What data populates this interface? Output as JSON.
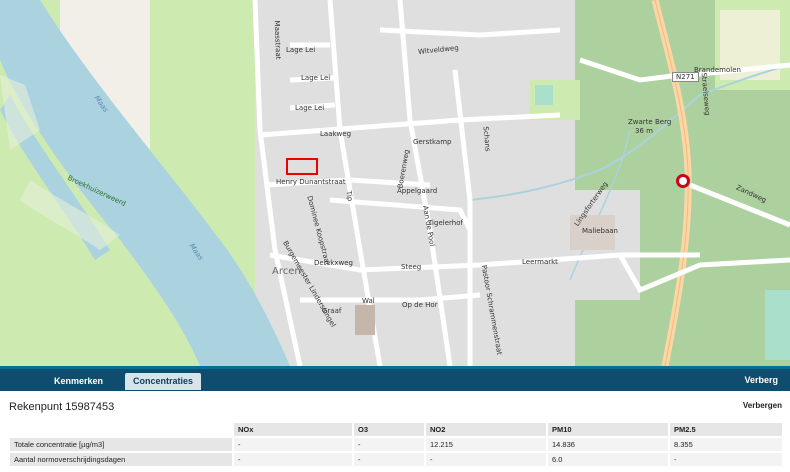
{
  "map": {
    "labels": {
      "lage_lei_1": "Lage Lei",
      "lage_lei_2": "Lage Lei",
      "lage_lei_3": "Lage Lei",
      "witveldweg": "Witveldweg",
      "laakweg": "Laakweg",
      "gerstkamp": "Gerstkamp",
      "henry_dunant": "Henry Dunantstraat",
      "dominee_koopstraat": "Dominee Koopstraat",
      "derckxweg": "Derckxweg",
      "arcen": "Arcen",
      "steeg": "Steeg",
      "leermarkt": "Leermarkt",
      "graaf": "Graaf",
      "op_de_hor": "Op de Hor",
      "wal": "Wal",
      "pastoor_schrammenstraat": "Pastoor Schrammenstraat",
      "maasstraat": "Maasstraat",
      "burgemeester": "Burgemeester Linderssingel",
      "zwarte_berg": "Zwarte Berg",
      "zwarte_berg_height": "36 m",
      "maliebaan": "Maliebaan",
      "brandemolen": "Brandemolen",
      "zandweg": "Zandweg",
      "broekhuizerweerd": "Broekhuizerweerd",
      "maas": "Maas",
      "n271": "N271",
      "straelseweg": "Straelseweg",
      "tigelerhof": "Tigelerhof",
      "appelgaard": "Appelgaard",
      "aan_de_pool": "Aan de Pool",
      "boerenweg": "Boerenweg",
      "schans": "Schans",
      "lingsforterweg": "Lingsforterweg",
      "tip": "Tip"
    },
    "route_shield": "N271"
  },
  "panel": {
    "tabs": [
      {
        "label": "Kenmerken"
      },
      {
        "label": "Concentraties"
      }
    ],
    "hide_top": "Verberg",
    "hide_bottom": "Verbergen",
    "title": "Rekenpunt 15987453",
    "table": {
      "headers": [
        "",
        "NOx",
        "O3",
        "NO2",
        "PM10",
        "PM2.5"
      ],
      "rows": [
        [
          "Totale concentratie [µg/m3]",
          "-",
          "-",
          "12.215",
          "14.836",
          "8.355"
        ],
        [
          "Aantal normoverschrijdingsdagen",
          "-",
          "-",
          "-",
          "6.0",
          "-"
        ]
      ]
    }
  },
  "colors": {
    "panel_bar": "#0f4d6e",
    "marker": "#d0021b"
  }
}
